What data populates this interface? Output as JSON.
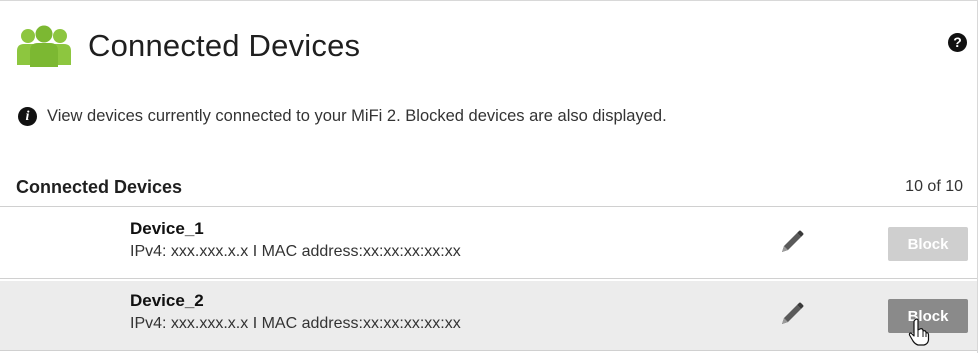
{
  "page": {
    "title": "Connected Devices",
    "header_icon": "people-group-icon",
    "help_icon": "help-icon",
    "help_label": "?"
  },
  "info": {
    "icon": "info-icon",
    "icon_label": "i",
    "text": "View devices currently connected to your MiFi 2. Blocked devices are also displayed."
  },
  "section": {
    "title": "Connected Devices",
    "count": "10 of 10"
  },
  "devices": [
    {
      "name": "Device_1",
      "info": "IPv4: xxx.xxx.x.x I MAC address:xx:xx:xx:xx:xx",
      "edit_icon": "pencil-icon",
      "block_label": "Block",
      "block_state": "disabled"
    },
    {
      "name": "Device_2",
      "info": "IPv4: xxx.xxx.x.x I MAC address:xx:xx:xx:xx:xx",
      "edit_icon": "pencil-icon",
      "block_label": "Block",
      "block_state": "hover"
    }
  ],
  "colors": {
    "header_icon_green": "#8dc63f",
    "block_disabled": "#cfcfcf",
    "block_active": "#8a8a8a",
    "hover_row": "#ececec"
  }
}
